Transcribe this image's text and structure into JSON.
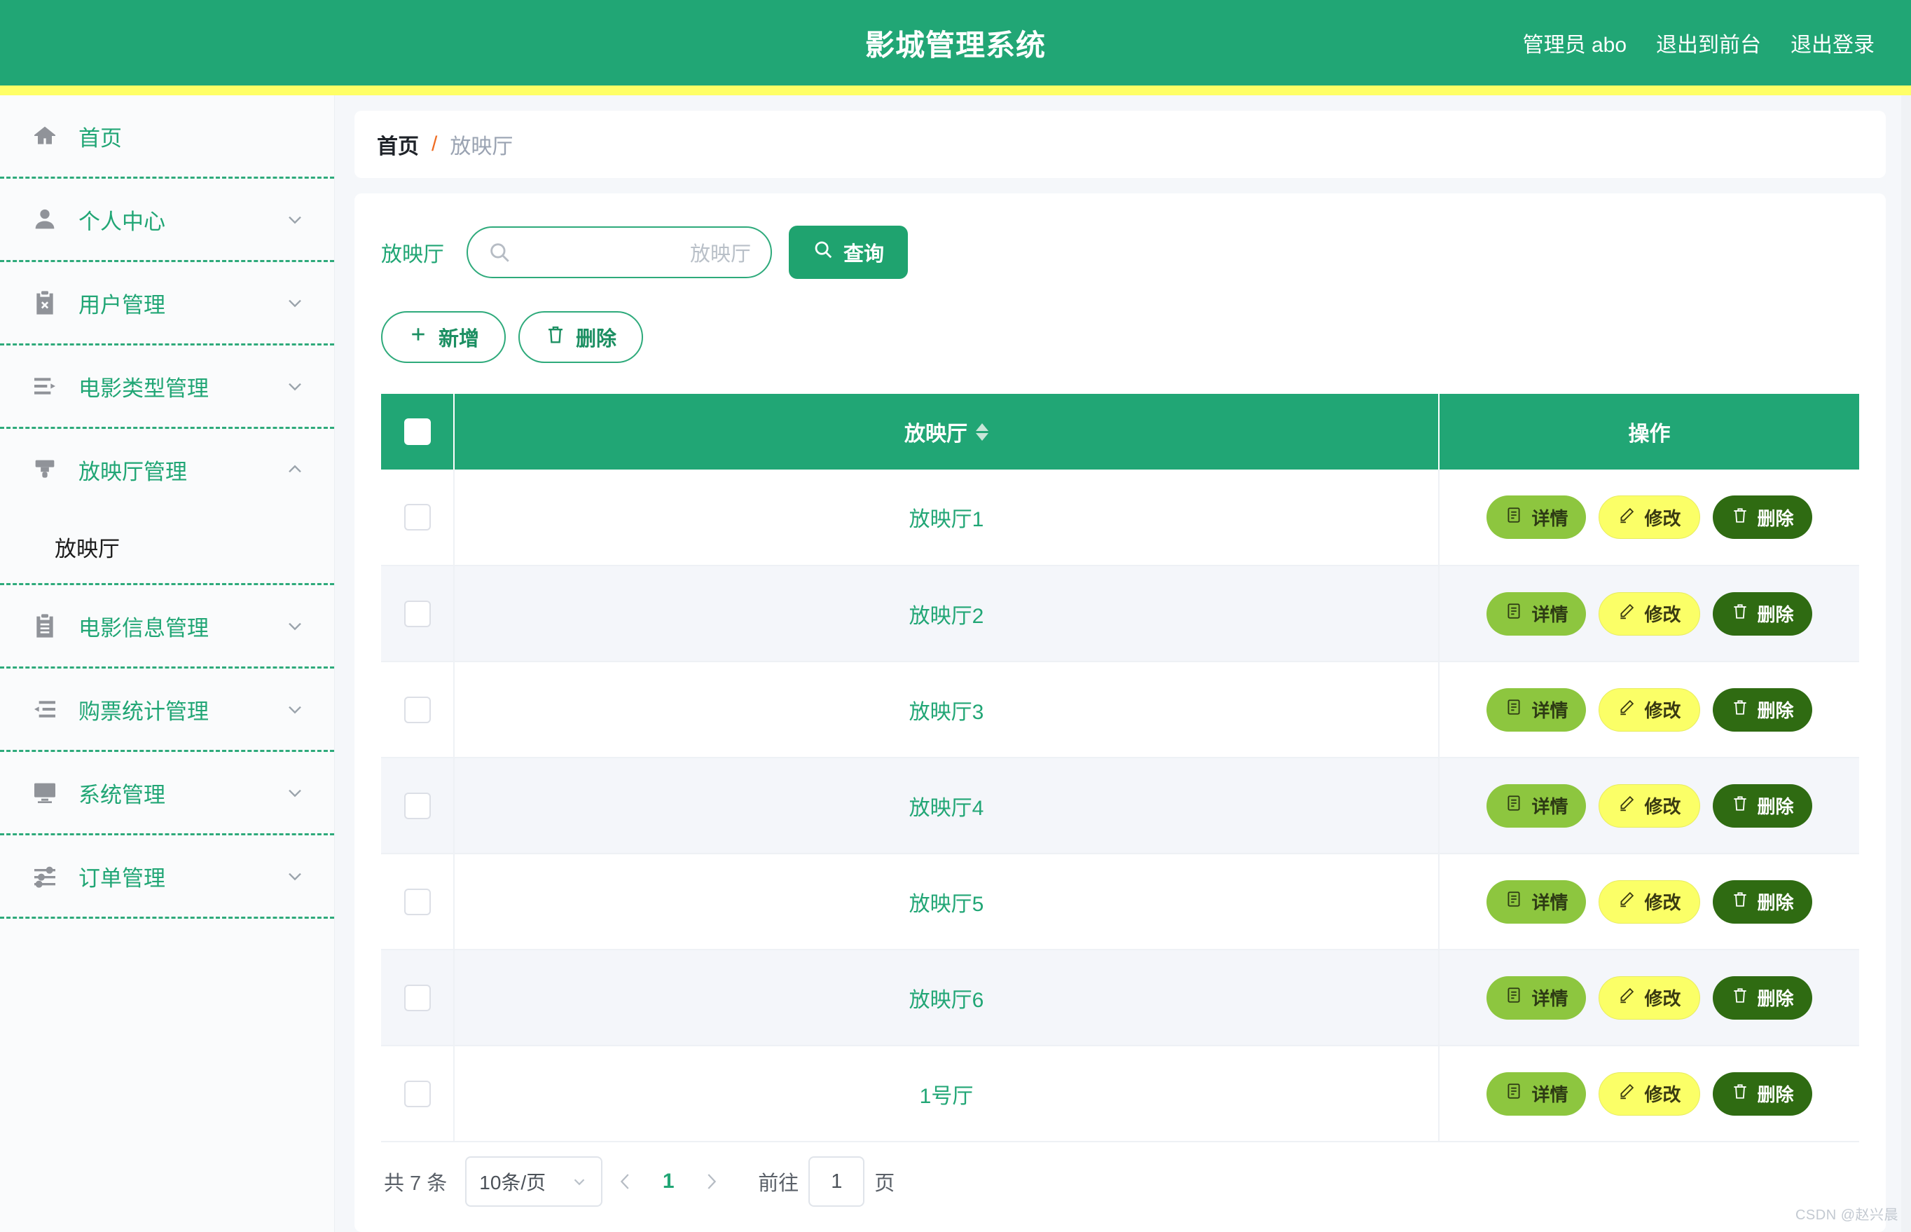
{
  "header": {
    "title": "影城管理系统",
    "links": [
      "管理员 abo",
      "退出到前台",
      "退出登录"
    ],
    "bg_color": "#21a675",
    "accent_strip_color": "#ffff66"
  },
  "sidebar": {
    "items": [
      {
        "label": "首页",
        "icon": "home-icon",
        "expandable": false
      },
      {
        "label": "个人中心",
        "icon": "user-icon",
        "expandable": true,
        "arrow": "down"
      },
      {
        "label": "用户管理",
        "icon": "clipboard-x-icon",
        "expandable": true,
        "arrow": "down"
      },
      {
        "label": "电影类型管理",
        "icon": "list-play-icon",
        "expandable": true,
        "arrow": "down"
      },
      {
        "label": "放映厅管理",
        "icon": "projector-icon",
        "expandable": true,
        "arrow": "up",
        "expanded": true,
        "children": [
          {
            "label": "放映厅",
            "active": true
          }
        ]
      },
      {
        "label": "电影信息管理",
        "icon": "clipboard-icon",
        "expandable": true,
        "arrow": "down"
      },
      {
        "label": "购票统计管理",
        "icon": "list-back-icon",
        "expandable": true,
        "arrow": "down"
      },
      {
        "label": "系统管理",
        "icon": "monitor-icon",
        "expandable": true,
        "arrow": "down"
      },
      {
        "label": "订单管理",
        "icon": "sliders-icon",
        "expandable": true,
        "arrow": "down"
      }
    ]
  },
  "breadcrumb": {
    "home": "首页",
    "separator": "/",
    "current": "放映厅"
  },
  "search": {
    "label": "放映厅",
    "placeholder": "放映厅",
    "value": "",
    "icon": "search-icon",
    "query_button": "查询"
  },
  "actions": {
    "add": {
      "label": "新增",
      "icon": "plus-icon"
    },
    "delete": {
      "label": "删除",
      "icon": "trash-icon"
    }
  },
  "table": {
    "columns": [
      "",
      "放映厅",
      "操作"
    ],
    "sortable_column": "放映厅",
    "sort_icon": "sort-updown-icon",
    "rows": [
      {
        "name": "放映厅1",
        "checked": false
      },
      {
        "name": "放映厅2",
        "checked": false
      },
      {
        "name": "放映厅3",
        "checked": false
      },
      {
        "name": "放映厅4",
        "checked": false
      },
      {
        "name": "放映厅5",
        "checked": false
      },
      {
        "name": "放映厅6",
        "checked": false
      },
      {
        "name": "1号厅",
        "checked": false
      }
    ],
    "row_buttons": {
      "detail": {
        "label": "详情",
        "icon": "document-icon",
        "color": "#8dc63f"
      },
      "edit": {
        "label": "修改",
        "icon": "pencil-icon",
        "color": "#fbff67"
      },
      "delete": {
        "label": "删除",
        "icon": "trash-icon",
        "color": "#2f6b12"
      }
    }
  },
  "pagination": {
    "total_text": "共 7 条",
    "page_size": "10条/页",
    "prev_icon": "chevron-left-icon",
    "next_icon": "chevron-right-icon",
    "current_page": "1",
    "goto_label": "前往",
    "goto_value": "1",
    "page_unit": "页"
  },
  "watermark": "CSDN @赵兴晨"
}
